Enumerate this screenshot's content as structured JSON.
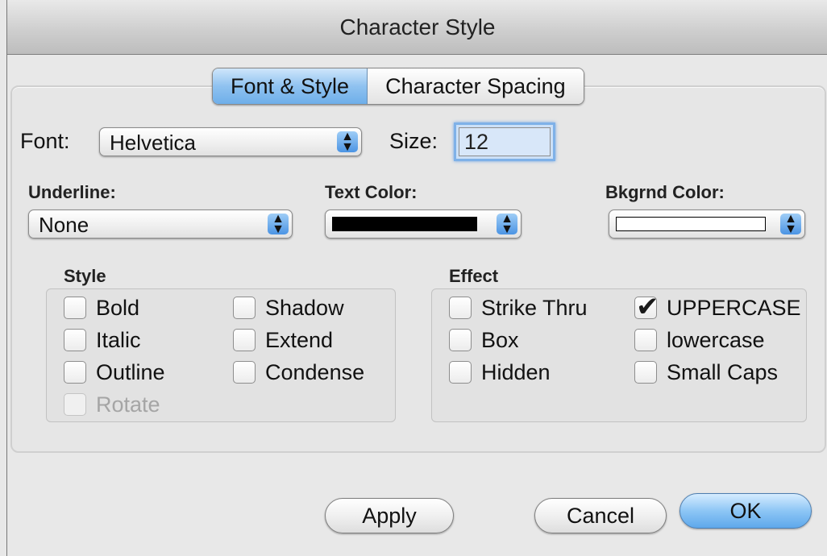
{
  "window": {
    "title": "Character Style"
  },
  "tabs": [
    {
      "label": "Font & Style",
      "active": true
    },
    {
      "label": "Character Spacing",
      "active": false
    }
  ],
  "font": {
    "label": "Font:",
    "value": "Helvetica"
  },
  "size": {
    "label": "Size:",
    "value": "12"
  },
  "underline": {
    "label": "Underline:",
    "value": "None"
  },
  "text_color": {
    "label": "Text Color:",
    "color": "#000000"
  },
  "bkgrnd_color": {
    "label": "Bkgrnd Color:",
    "color": "#ffffff"
  },
  "style_group": {
    "title": "Style",
    "items": [
      {
        "label": "Bold",
        "checked": false,
        "enabled": true
      },
      {
        "label": "Italic",
        "checked": false,
        "enabled": true
      },
      {
        "label": "Outline",
        "checked": false,
        "enabled": true
      },
      {
        "label": "Rotate",
        "checked": false,
        "enabled": false
      },
      {
        "label": "Shadow",
        "checked": false,
        "enabled": true
      },
      {
        "label": "Extend",
        "checked": false,
        "enabled": true
      },
      {
        "label": "Condense",
        "checked": false,
        "enabled": true
      }
    ]
  },
  "effect_group": {
    "title": "Effect",
    "items": [
      {
        "label": "Strike Thru",
        "checked": false,
        "enabled": true
      },
      {
        "label": "Box",
        "checked": false,
        "enabled": true
      },
      {
        "label": "Hidden",
        "checked": false,
        "enabled": true
      },
      {
        "label": "UPPERCASE",
        "checked": true,
        "enabled": true
      },
      {
        "label": "lowercase",
        "checked": false,
        "enabled": true
      },
      {
        "label": "Small Caps",
        "checked": false,
        "enabled": true
      }
    ]
  },
  "buttons": {
    "apply": "Apply",
    "cancel": "Cancel",
    "ok": "OK"
  },
  "icons": {
    "popup_arrows": "updown-chevron-icon",
    "checkmark": "checkmark-icon"
  },
  "colors": {
    "accent": "#6eaee9"
  }
}
